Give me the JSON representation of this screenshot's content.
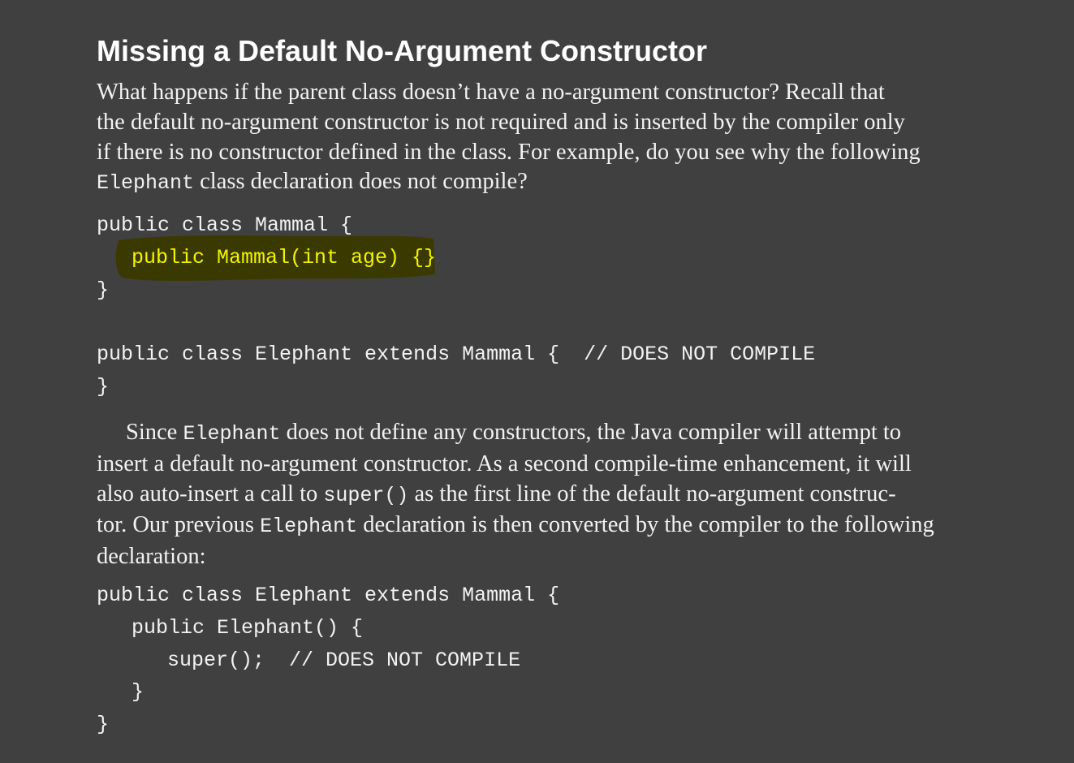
{
  "heading": "Missing a Default No-Argument Constructor",
  "intro": {
    "line1": "What happens if the parent class doesn’t have a no-argument constructor? Recall that",
    "line2": "the default no-argument constructor is not required and is inserted by the compiler only",
    "line3": "if there is no constructor defined in the class. For example, do you see why the following",
    "line4_code": "Elephant",
    "line4_text": " class declaration does not compile?"
  },
  "code1": {
    "l1": "public class Mammal {",
    "l2_highlighted": "public Mammal(int age) {}",
    "l3": "}",
    "l4": "",
    "l5": "public class Elephant extends Mammal {  // DOES NOT COMPILE",
    "l6": "}"
  },
  "explanation": {
    "l1_a": "Since ",
    "l1_code": "Elephant",
    "l1_b": " does not define any constructors, the Java compiler will attempt to",
    "l2": "insert a default no-argument constructor. As a second compile-time enhancement, it will",
    "l3_a": "also auto-insert a call to ",
    "l3_code": "super()",
    "l3_b": " as the first line of the default no-argument construc-",
    "l4_a": "tor. Our previous ",
    "l4_code": "Elephant",
    "l4_b": " declaration is then converted by the compiler to the following",
    "l5": "declaration:"
  },
  "code2": {
    "l1": "public class Elephant extends Mammal {",
    "l2": "public Elephant() {",
    "l3": "super();  // DOES NOT COMPILE",
    "l4": "}",
    "l5": "}"
  },
  "colors": {
    "background": "#404040",
    "text": "#f2f2f2",
    "highlight_fill": "#3a3a00",
    "highlight_text": "#f4f400"
  }
}
